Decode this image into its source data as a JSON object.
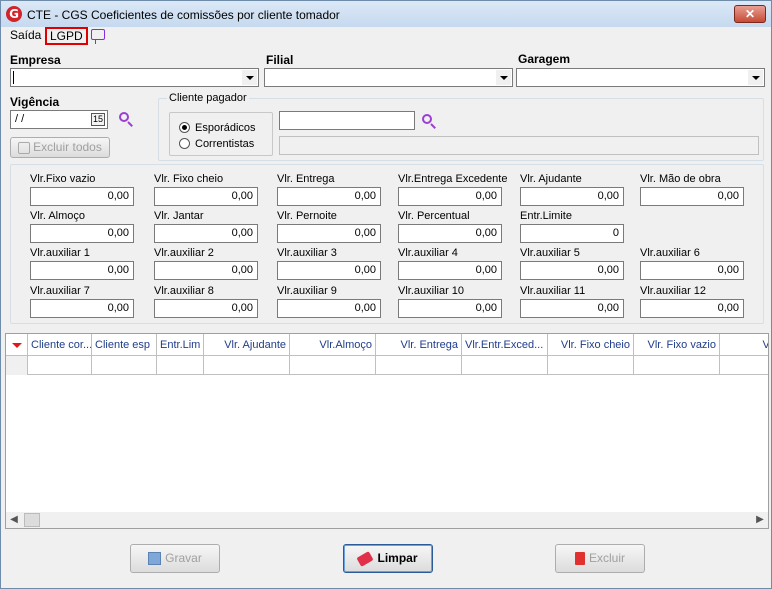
{
  "window": {
    "title": "CTE - CGS Coeficientes de comissões por cliente tomador",
    "close": "✕"
  },
  "menu": {
    "saida": "Saída",
    "lgpd": "LGPD"
  },
  "filters": {
    "empresa_label": "Empresa",
    "filial_label": "Filial",
    "garagem_label": "Garagem",
    "vigencia_label": "Vigência",
    "vigencia_value": " /  /",
    "cal_icon": "15",
    "cliente_pagador_title": "Cliente pagador",
    "esporadicos": "Esporádicos",
    "correntistas": "Correntistas",
    "excluir_todos": "Excluir todos"
  },
  "values": {
    "row1": [
      {
        "label": "Vlr.Fixo vazio",
        "value": "0,00"
      },
      {
        "label": "Vlr. Fixo cheio",
        "value": "0,00"
      },
      {
        "label": "Vlr. Entrega",
        "value": "0,00"
      },
      {
        "label": "Vlr.Entrega Excedente",
        "value": "0,00"
      },
      {
        "label": "Vlr. Ajudante",
        "value": "0,00"
      },
      {
        "label": "Vlr. Mão de obra",
        "value": "0,00"
      }
    ],
    "row2": [
      {
        "label": "Vlr. Almoço",
        "value": "0,00"
      },
      {
        "label": "Vlr. Jantar",
        "value": "0,00"
      },
      {
        "label": "Vlr. Pernoite",
        "value": "0,00"
      },
      {
        "label": "Vlr. Percentual",
        "value": "0,00"
      },
      {
        "label": "Entr.Limite",
        "value": "0"
      }
    ],
    "row3": [
      {
        "label": "Vlr.auxiliar 1",
        "value": "0,00"
      },
      {
        "label": "Vlr.auxiliar 2",
        "value": "0,00"
      },
      {
        "label": "Vlr.auxiliar 3",
        "value": "0,00"
      },
      {
        "label": "Vlr.auxiliar 4",
        "value": "0,00"
      },
      {
        "label": "Vlr.auxiliar 5",
        "value": "0,00"
      },
      {
        "label": "Vlr.auxiliar 6",
        "value": "0,00"
      }
    ],
    "row4": [
      {
        "label": "Vlr.auxiliar 7",
        "value": "0,00"
      },
      {
        "label": "Vlr.auxiliar 8",
        "value": "0,00"
      },
      {
        "label": "Vlr.auxiliar 9",
        "value": "0,00"
      },
      {
        "label": "Vlr.auxiliar 10",
        "value": "0,00"
      },
      {
        "label": "Vlr.auxiliar 11",
        "value": "0,00"
      },
      {
        "label": "Vlr.auxiliar 12",
        "value": "0,00"
      }
    ]
  },
  "grid": {
    "columns": [
      "Cliente cor...",
      "Cliente esp",
      "Entr.Lim",
      "Vlr. Ajudante",
      "Vlr.Almoço",
      "Vlr. Entrega",
      "Vlr.Entr.Exced...",
      "Vlr. Fixo cheio",
      "Vlr. Fixo vazio",
      "Vlr"
    ],
    "scroll_left": "◀",
    "scroll_right": "▶"
  },
  "buttons": {
    "gravar": "Gravar",
    "limpar": "Limpar",
    "excluir": "Excluir"
  },
  "colors": {
    "accent": "#9b3fd4",
    "header_text": "#1f3d8a",
    "highlight": "#e00000"
  }
}
